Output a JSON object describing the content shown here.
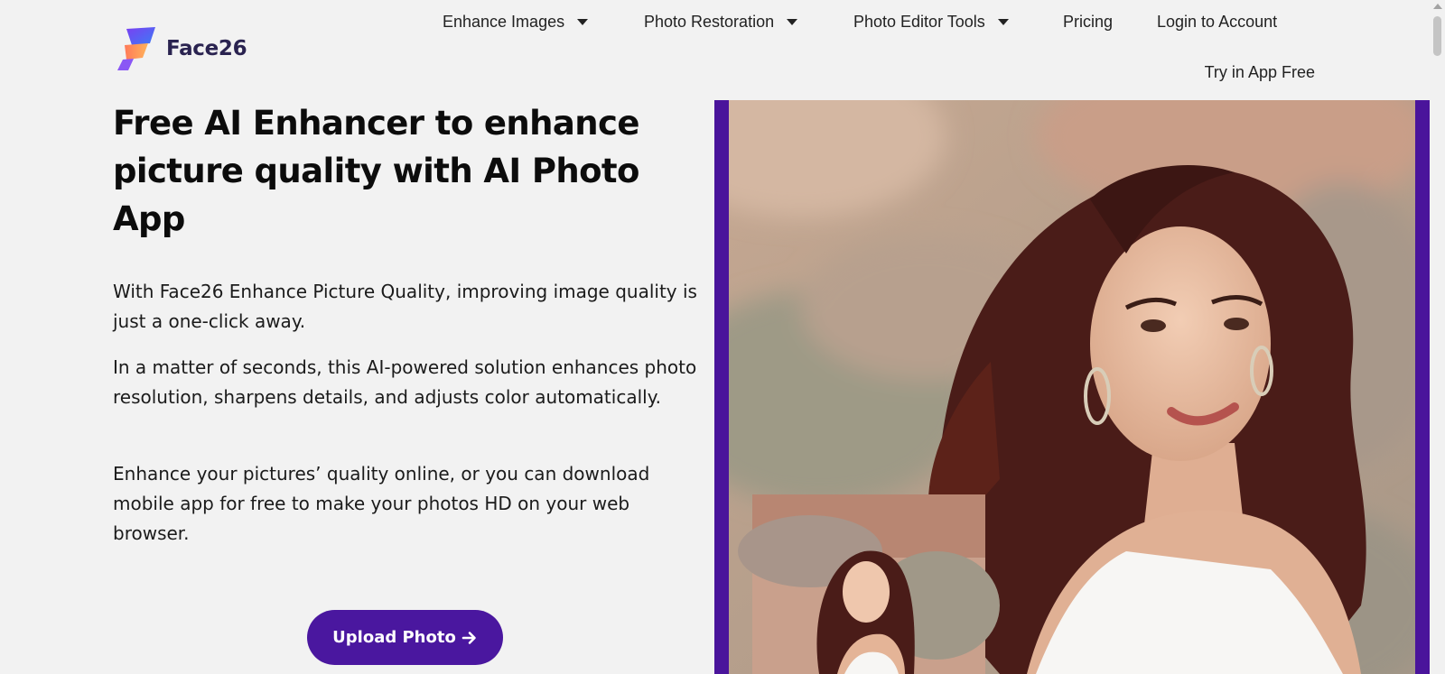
{
  "brand": {
    "name": "Face26"
  },
  "nav": {
    "items": [
      {
        "label": "Enhance Images",
        "dropdown": true
      },
      {
        "label": "Photo Restoration",
        "dropdown": true
      },
      {
        "label": "Photo Editor Tools",
        "dropdown": true
      },
      {
        "label": "Pricing",
        "dropdown": false
      },
      {
        "label": "Login to Account",
        "dropdown": false
      }
    ],
    "try_app": "Try in App Free"
  },
  "hero": {
    "title": "Free AI Enhancer to enhance picture quality with AI Photo App",
    "paragraphs": [
      "With Face26 Enhance Picture Quality, improving image quality is just a one-click away.",
      "In a matter of seconds, this AI-powered solution enhances photo resolution, sharpens details, and adjusts color automatically.",
      "Enhance your pictures’ quality online, or you can download mobile app for free to make your photos HD on your web browser."
    ],
    "upload_label": "Upload Photo",
    "upload_icon": "arrow-right-icon"
  },
  "colors": {
    "accent": "#4a179f",
    "frame": "#4a149b",
    "background": "#f2f2f2"
  }
}
